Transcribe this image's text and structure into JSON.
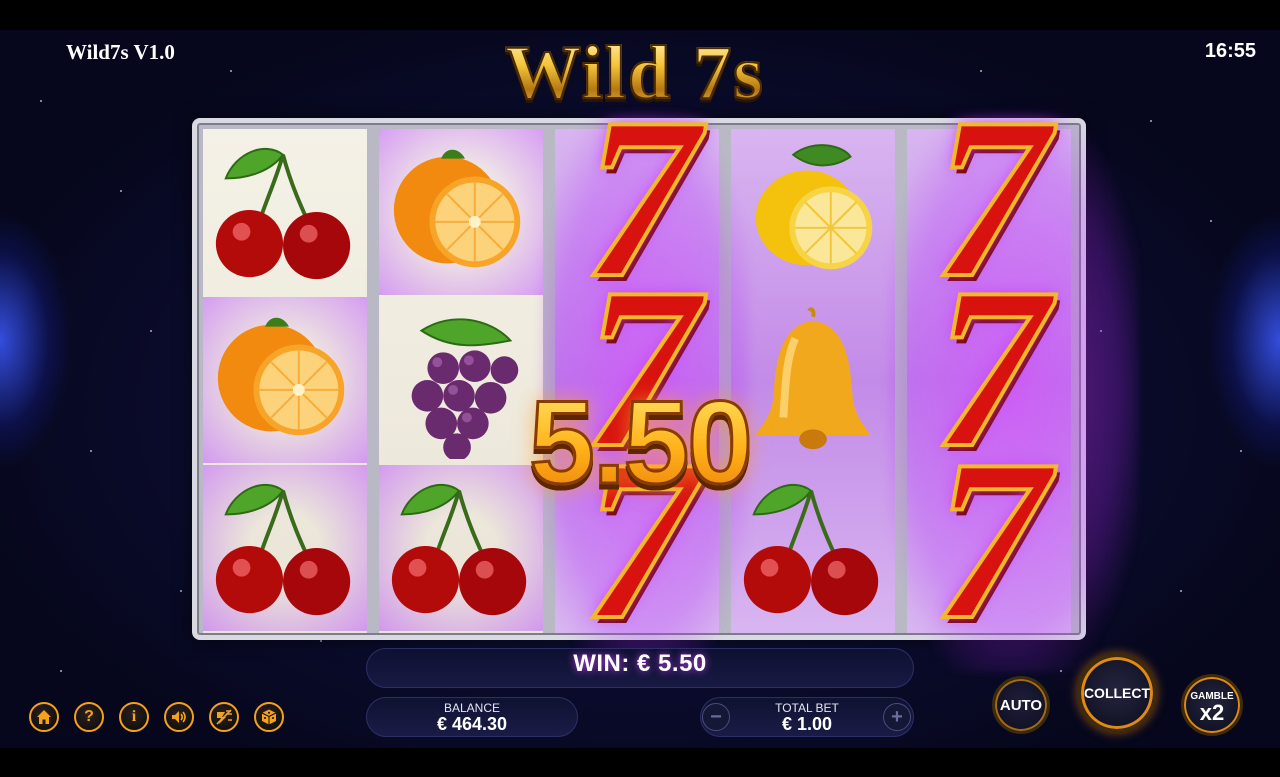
{
  "header": {
    "app_title": "Wild7s V1.0",
    "clock": "16:55",
    "logo": "Wild 7s"
  },
  "reels": [
    {
      "symbols": [
        "cherry-icon",
        "orange-icon",
        "cherry-icon"
      ]
    },
    {
      "symbols": [
        "orange-icon",
        "grape-icon",
        "cherry-icon"
      ]
    },
    {
      "symbols": [
        "seven-icon",
        "seven-icon",
        "seven-icon"
      ]
    },
    {
      "symbols": [
        "lemon-icon",
        "bell-icon",
        "cherry-icon"
      ]
    },
    {
      "symbols": [
        "seven-icon",
        "seven-icon",
        "seven-icon"
      ]
    }
  ],
  "seven_glyph": "7",
  "win_amount": "5.50",
  "win_bar": {
    "text": "WIN: € 5.50"
  },
  "balance": {
    "label": "BALANCE",
    "value": "€ 464.30"
  },
  "total_bet": {
    "label": "TOTAL BET",
    "value": "€ 1.00",
    "minus": "−",
    "plus": "+"
  },
  "toolbar": {
    "home": "home-icon",
    "help": "?",
    "info": "i",
    "sound": "speaker-icon",
    "fast": "fast-play-icon",
    "dice": "dice-icon"
  },
  "buttons": {
    "auto": "AUTO",
    "collect": "COLLECT",
    "gamble_label": "GAMBLE",
    "gamble_mult": "x2"
  },
  "colors": {
    "accent_orange": "#f4a11c",
    "seven_red": "#d8130f",
    "win_gold": "#ffb119",
    "glow_purple": "#c35cff"
  }
}
